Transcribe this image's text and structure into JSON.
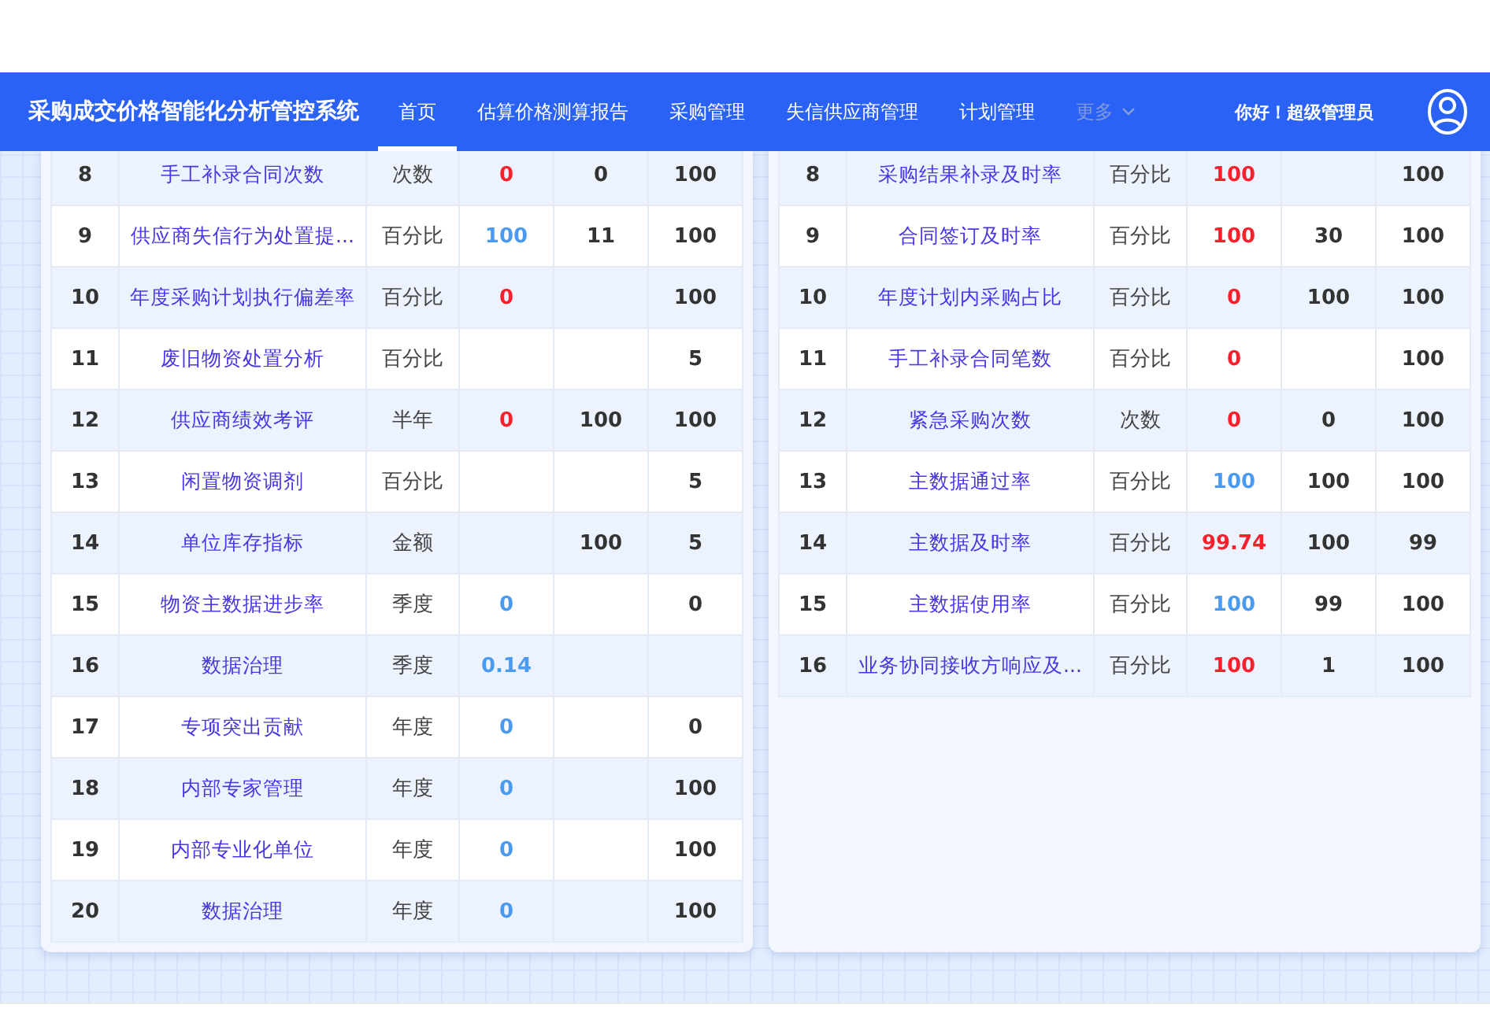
{
  "header": {
    "title": "采购成交价格智能化分析管控系统",
    "nav": [
      {
        "label": "首页",
        "selected": true,
        "disabled": false
      },
      {
        "label": "估算价格测算报告",
        "selected": false,
        "disabled": false
      },
      {
        "label": "采购管理",
        "selected": false,
        "disabled": false
      },
      {
        "label": "失信供应商管理",
        "selected": false,
        "disabled": false
      },
      {
        "label": "计划管理",
        "selected": false,
        "disabled": false
      },
      {
        "label": "更多",
        "selected": false,
        "disabled": true
      }
    ],
    "greeting": "你好！超级管理员"
  },
  "tables": [
    {
      "rows": [
        {
          "column_1": "8",
          "column_2": "手工补录合同次数",
          "column_3": "次数",
          "column_4": "0",
          "color": "#f5222d",
          "column_5": "0",
          "column_6": "100"
        },
        {
          "column_1": "9",
          "column_2": "供应商失信行为处置提...",
          "column_3": "百分比",
          "column_4": "100",
          "color": "#4a9bf0",
          "column_5": "11",
          "column_6": "100"
        },
        {
          "column_1": "10",
          "column_2": "年度采购计划执行偏差率",
          "column_3": "百分比",
          "column_4": "0",
          "color": "#f5222d",
          "column_5": "",
          "column_6": "100"
        },
        {
          "column_1": "11",
          "column_2": "废旧物资处置分析",
          "column_3": "百分比",
          "column_4": "",
          "column_5": "",
          "column_6": "5"
        },
        {
          "column_1": "12",
          "column_2": "供应商绩效考评",
          "column_3": "半年",
          "column_4": "0",
          "color": "#f5222d",
          "column_5": "100",
          "column_6": "100"
        },
        {
          "column_1": "13",
          "column_2": "闲置物资调剂",
          "column_3": "百分比",
          "column_4": "",
          "column_5": "",
          "column_6": "5"
        },
        {
          "column_1": "14",
          "column_2": "单位库存指标",
          "column_3": "金额",
          "column_4": "",
          "column_5": "100",
          "column_6": "5"
        },
        {
          "column_1": "15",
          "column_2": "物资主数据进步率",
          "column_3": "季度",
          "column_4": "0",
          "color": "#4a9bf0",
          "column_5": "",
          "column_6": "0"
        },
        {
          "column_1": "16",
          "column_2": "数据治理",
          "column_3": "季度",
          "column_4": "0.14",
          "color": "#4a9bf0",
          "column_5": "",
          "column_6": ""
        },
        {
          "column_1": "17",
          "column_2": "专项突出贡献",
          "column_3": "年度",
          "column_4": "0",
          "color": "#4a9bf0",
          "column_5": "",
          "column_6": "0"
        },
        {
          "column_1": "18",
          "column_2": "内部专家管理",
          "column_3": "年度",
          "column_4": "0",
          "color": "#4a9bf0",
          "column_5": "",
          "column_6": "100"
        },
        {
          "column_1": "19",
          "column_2": "内部专业化单位",
          "column_3": "年度",
          "column_4": "0",
          "color": "#4a9bf0",
          "column_5": "",
          "column_6": "100"
        },
        {
          "column_1": "20",
          "column_2": "数据治理",
          "column_3": "年度",
          "column_4": "0",
          "color": "#4a9bf0",
          "column_5": "",
          "column_6": "100"
        }
      ]
    },
    {
      "rows": [
        {
          "column_1": "8",
          "column_2": "采购结果补录及时率",
          "column_3": "百分比",
          "column_4": "100",
          "color": "#f5222d",
          "column_5": "",
          "column_6": "100"
        },
        {
          "column_1": "9",
          "column_2": "合同签订及时率",
          "column_3": "百分比",
          "column_4": "100",
          "color": "#f5222d",
          "column_5": "30",
          "column_6": "100"
        },
        {
          "column_1": "10",
          "column_2": "年度计划内采购占比",
          "column_3": "百分比",
          "column_4": "0",
          "color": "#f5222d",
          "column_5": "100",
          "column_6": "100"
        },
        {
          "column_1": "11",
          "column_2": "手工补录合同笔数",
          "column_3": "百分比",
          "column_4": "0",
          "color": "#f5222d",
          "column_5": "",
          "column_6": "100"
        },
        {
          "column_1": "12",
          "column_2": "紧急采购次数",
          "column_3": "次数",
          "column_4": "0",
          "color": "#f5222d",
          "column_5": "0",
          "column_6": "100"
        },
        {
          "column_1": "13",
          "column_2": "主数据通过率",
          "column_3": "百分比",
          "column_4": "100",
          "color": "#4a9bf0",
          "column_5": "100",
          "column_6": "100"
        },
        {
          "column_1": "14",
          "column_2": "主数据及时率",
          "column_3": "百分比",
          "column_4": "99.74",
          "color": "#f5222d",
          "column_5": "100",
          "column_6": "99"
        },
        {
          "column_1": "15",
          "column_2": "主数据使用率",
          "column_3": "百分比",
          "column_4": "100",
          "color": "#4a9bf0",
          "column_5": "99",
          "column_6": "100"
        },
        {
          "column_1": "16",
          "column_2": "业务协同接收方响应及...",
          "column_3": "百分比",
          "column_4": "100",
          "color": "#f5222d",
          "column_5": "1",
          "column_6": "100"
        }
      ]
    }
  ]
}
